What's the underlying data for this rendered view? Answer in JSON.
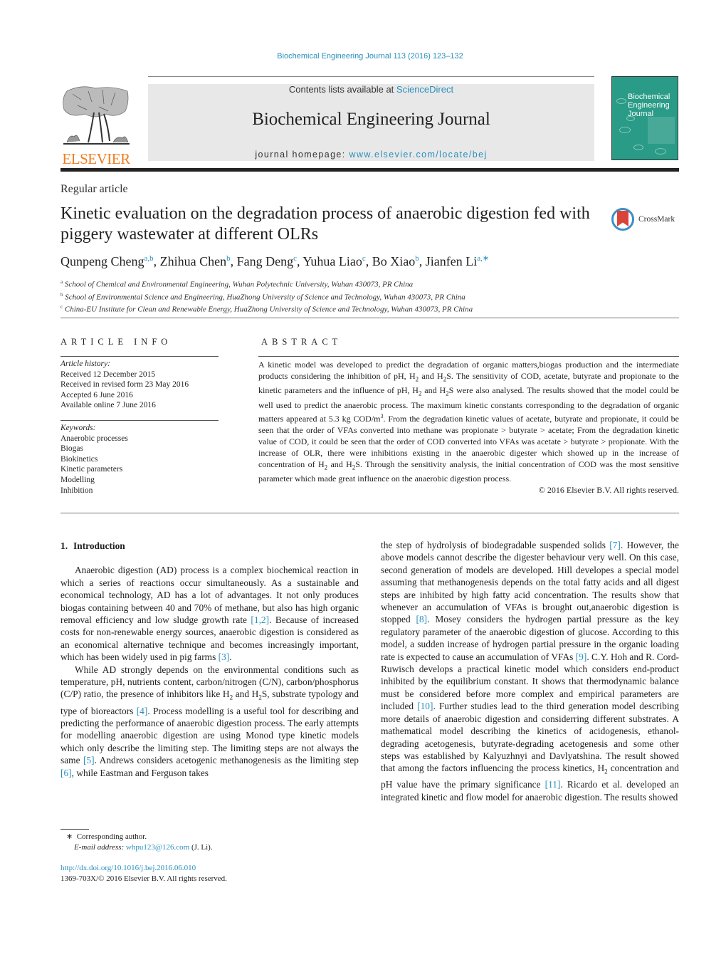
{
  "header": {
    "journal_ref": "Biochemical Engineering Journal 113 (2016) 123–132",
    "contents_prefix": "Contents lists available at ",
    "contents_link": "ScienceDirect",
    "journal_title": "Biochemical Engineering Journal",
    "homepage_prefix": "journal homepage: ",
    "homepage_link": "www.elsevier.com/locate/bej",
    "publisher_logo": "ELSEVIER",
    "cover_title_lines": [
      "Biochemical",
      "Engineering",
      "Journal"
    ]
  },
  "article": {
    "type": "Regular article",
    "title": "Kinetic evaluation on the degradation process of anaerobic digestion fed with piggery wastewater at different OLRs",
    "crossmark_label": "CrossMark",
    "authors": [
      {
        "name": "Qunpeng Cheng",
        "sup": "a,b"
      },
      {
        "name": "Zhihua Chen",
        "sup": "b"
      },
      {
        "name": "Fang Deng",
        "sup": "c"
      },
      {
        "name": "Yuhua Liao",
        "sup": "c"
      },
      {
        "name": "Bo Xiao",
        "sup": "b"
      },
      {
        "name": "Jianfen Li",
        "sup": "a,∗"
      }
    ],
    "affiliations": [
      {
        "key": "a",
        "text": "School of Chemical and Environmental Engineering, Wuhan Polytechnic University, Wuhan 430073, PR China"
      },
      {
        "key": "b",
        "text": "School of Environmental Science and Engineering, HuaZhong University of Science and Technology, Wuhan 430073, PR China"
      },
      {
        "key": "c",
        "text": "China-EU Institute for Clean and Renewable Energy, HuaZhong University of Science and Technology, Wuhan 430073, PR China"
      }
    ]
  },
  "article_info": {
    "heading": "ARTICLE INFO",
    "history_label": "Article history:",
    "history": [
      "Received 12 December 2015",
      "Received in revised form 23 May 2016",
      "Accepted 6 June 2016",
      "Available online 7 June 2016"
    ],
    "keywords_label": "Keywords:",
    "keywords": [
      "Anaerobic processes",
      "Biogas",
      "Biokinetics",
      "Kinetic parameters",
      "Modelling",
      "Inhibition"
    ]
  },
  "abstract": {
    "heading": "ABSTRACT",
    "p1": "A kinetic model was developed to predict the degradation of organic matters,biogas production and the intermediate products considering the inhibition of pH, H",
    "p2": " and H",
    "p3": "S. The sensitivity of COD, acetate, butyrate and propionate to the kinetic parameters and the influence of pH, H",
    "p4": " and H",
    "p5": "S were also analysed. The results showed that the model could be well used to predict the anaerobic process. The maximum kinetic constants corresponding to the degradation of organic matters appeared at 5.3 kg COD/m",
    "p5_sup": "3",
    "p6": ". From the degradation kinetic values of acetate, butyrate and propionate, it could be seen that the order of VFAs converted into methane was propionate > butyrate > acetate; From the degradation kinetic value of COD, it could be seen that the order of COD converted into VFAs was acetate > butyrate > propionate. With the increase of OLR, there were inhibitions existing in the anaerobic digester which showed up in the increase of concentration of H",
    "p7": " and H",
    "p8": "S. Through the sensitivity analysis, the initial concentration of COD was the most sensitive parameter which made great influence on the anaerobic digestion process.",
    "sub2": "2",
    "copyright": "© 2016 Elsevier B.V. All rights reserved."
  },
  "body": {
    "section_number": "1.",
    "section_title": "Introduction",
    "para1": {
      "a": "Anaerobic digestion (AD) process is a complex biochemical reaction in which a series of reactions occur simultaneously. As a sustainable and economical technology, AD has a lot of advantages. It not only produces biogas containing between 40 and 70% of methane, but also has high organic removal efficiency and low sludge growth rate ",
      "ref1": "[1,2]",
      "b": ". Because of increased costs for non-renewable energy sources, anaerobic digestion is considered as an economical alternative technique and becomes increasingly important, which has been widely used in pig farms ",
      "ref2": "[3]",
      "c": "."
    },
    "para2": {
      "a": "While AD strongly depends on the environmental conditions such as temperature, pH, nutrients content, carbon/nitrogen (C/N), carbon/phosphorus (C/P) ratio, the presence of inhibitors like H",
      "b": " and H",
      "c": "S, substrate typology and type of bioreactors ",
      "ref4": "[4]",
      "d": ". Process modelling is a useful tool for describing and predicting the performance of anaerobic digestion process. The early attempts for modelling anaerobic digestion are using Monod type kinetic models which only describe the limiting step. The limiting steps are not always the same ",
      "ref5": "[5]",
      "e": ". Andrews considers acetogenic methanogenesis as the limiting step ",
      "ref6": "[6]",
      "f": ", while Eastman and Ferguson takes"
    },
    "para3": {
      "a": "the step of hydrolysis of biodegradable suspended solids ",
      "ref7": "[7]",
      "b": ". However, the above models cannot describe the digester behaviour very well. On this case, second generation of models are developed. Hill developes a special model assuming that methanogenesis depends on the total fatty acids and all digest steps are inhibited by high fatty acid concentration. The results show that whenever an accumulation of VFAs is brought out,anaerobic digestion is stopped ",
      "ref8": "[8]",
      "c": ". Mosey considers the hydrogen partial pressure as the key regulatory parameter of the anaerobic digestion of glucose. According to this model, a sudden increase of hydrogen partial pressure in the organic loading rate is expected to cause an accumulation of VFAs ",
      "ref9": "[9]",
      "d": ". C.Y. Hoh and R. Cord-Ruwisch develops a practical kinetic model which considers end-product inhibited by the equilibrium constant. It shows that thermodynamic balance must be considered before more complex and empirical parameters are included ",
      "ref10": "[10]",
      "e": ". Further studies lead to the third generation model describing more details of anaerobic digestion and considerring different substrates. A mathematical model describing the kinetics of acidogenesis, ethanol-degrading acetogenesis, butyrate-degrading acetogenesis and some other steps was established by Kalyuzhnyi and Davlyatshina. The result showed that among the factors influencing the process kinetics, H",
      "f": " concentration and pH value have the primary significance ",
      "ref11": "[11]",
      "g": ". Ricardo et al. developed an integrated kinetic and flow model for anaerobic digestion. The results showed"
    }
  },
  "footer": {
    "corresponding_mark": "∗",
    "corresponding_label": "Corresponding author.",
    "email_label": "E-mail address: ",
    "email": "whpu123@126.com",
    "email_suffix": " (J. Li).",
    "doi": "http://dx.doi.org/10.1016/j.bej.2016.06.010",
    "issn_copyright": "1369-703X/© 2016 Elsevier B.V. All rights reserved."
  }
}
